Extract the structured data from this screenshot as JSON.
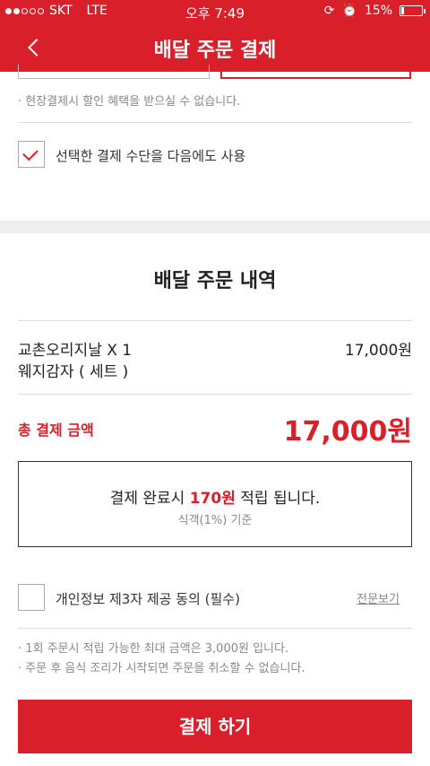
{
  "status_bar": {
    "carrier": "SKT",
    "network": "LTE",
    "time": "오후 7:49",
    "battery": "15%",
    "battery_level": 0.15
  },
  "header": {
    "title": "배달 주문 결제"
  },
  "payment": {
    "onsite_note": "· 현장결제시 할인 혜택을 받으실 수 없습니다.",
    "remember_method_label": "선택한 결제 수단을 다음에도 사용",
    "remember_method_checked": true
  },
  "order": {
    "section_title": "배달 주문 내역",
    "items": [
      {
        "name": "교촌오리지날 X 1",
        "option": "웨지감자 ( 세트 )",
        "price": "17,000원"
      }
    ],
    "total_label": "총 결제 금액",
    "total_value": "17,000원"
  },
  "points": {
    "prefix": "결제 완료시 ",
    "amount": "170원",
    "suffix": " 적립 됩니다.",
    "basis": "식객(1%) 기준"
  },
  "agreement": {
    "label": "개인정보 제3자 제공 동의 (필수)",
    "link": "전문보기",
    "checked": false
  },
  "notices": [
    "· 1회 주문시 적립 가능한 최대 금액은 3,000원 입니다.",
    "· 주문 후 음식 조리가 시작되면 주문을 취소할 수 없습니다."
  ],
  "pay_button": "결제 하기",
  "colors": {
    "brand_red": "#d9202a"
  }
}
